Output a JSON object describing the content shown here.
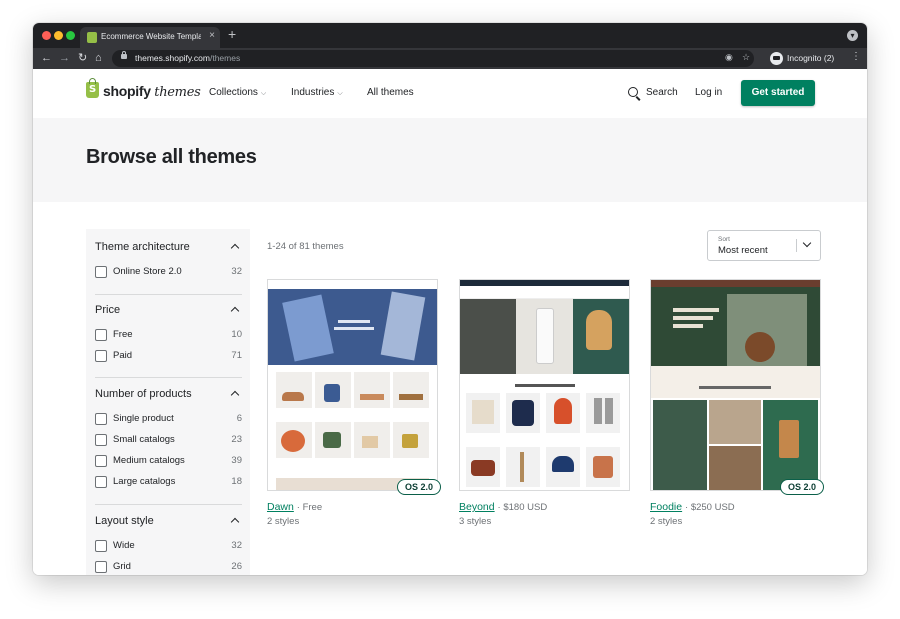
{
  "browser": {
    "tab_title": "Ecommerce Website Templates",
    "tab_close": "×",
    "new_tab": "+",
    "url_host": "themes.shopify.com",
    "url_path": "/themes",
    "incognito_label": "Incognito (2)"
  },
  "header": {
    "logo_bold": "shopify",
    "logo_italic": "themes",
    "nav": [
      {
        "label": "Collections",
        "has_menu": true
      },
      {
        "label": "Industries",
        "has_menu": true
      },
      {
        "label": "All themes",
        "has_menu": false
      }
    ],
    "search_label": "Search",
    "login_label": "Log in",
    "cta_label": "Get started"
  },
  "hero": {
    "title": "Browse all themes"
  },
  "filters": [
    {
      "heading": "Theme architecture",
      "options": [
        {
          "label": "Online Store 2.0",
          "count": "32"
        }
      ]
    },
    {
      "heading": "Price",
      "options": [
        {
          "label": "Free",
          "count": "10"
        },
        {
          "label": "Paid",
          "count": "71"
        }
      ]
    },
    {
      "heading": "Number of products",
      "options": [
        {
          "label": "Single product",
          "count": "6"
        },
        {
          "label": "Small catalogs",
          "count": "23"
        },
        {
          "label": "Medium catalogs",
          "count": "39"
        },
        {
          "label": "Large catalogs",
          "count": "18"
        }
      ]
    },
    {
      "heading": "Layout style",
      "options": [
        {
          "label": "Wide",
          "count": "32"
        },
        {
          "label": "Grid",
          "count": "26"
        }
      ]
    }
  ],
  "results": {
    "count_text": "1-24 of 81 themes",
    "sort_caption": "Sort",
    "sort_value": "Most recent"
  },
  "themes": [
    {
      "name": "Dawn",
      "price": "· Free",
      "styles": "2 styles",
      "badge": "OS 2.0"
    },
    {
      "name": "Beyond",
      "price": "· $180 USD",
      "styles": "3 styles",
      "badge": ""
    },
    {
      "name": "Foodie",
      "price": "· $250 USD",
      "styles": "2 styles",
      "badge": "OS 2.0"
    }
  ],
  "colors": {
    "brand_green": "#008060",
    "shopify_logo": "#95bf47",
    "hero_bg": "#f6f6f7",
    "browser_chrome": "#202124"
  }
}
